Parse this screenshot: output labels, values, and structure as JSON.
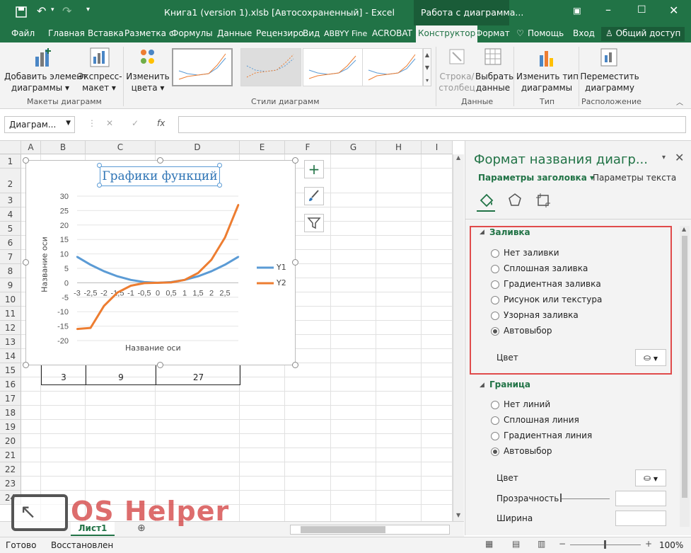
{
  "window": {
    "title": "Книга1 (version 1).xlsb [Автосохраненный] - Excel",
    "context_tab_title": "Работа с диаграмма..."
  },
  "ribbon_tabs": [
    "Файл",
    "Главная",
    "Вставка",
    "Разметка с",
    "Формулы",
    "Данные",
    "Рецензиро",
    "Вид",
    "ABBYY Fine",
    "ACROBAT",
    "Конструктор",
    "Формат"
  ],
  "ribbon_right": {
    "help": "Помощь",
    "signin": "Вход",
    "share": "Общий доступ"
  },
  "ribbon": {
    "add_element": [
      "Добавить элемент",
      "диаграммы ▾"
    ],
    "quick_layout": [
      "Экспресс-",
      "макет ▾"
    ],
    "change_colors": [
      "Изменить",
      "цвета ▾"
    ],
    "group_layouts": "Макеты диаграмм",
    "group_styles": "Стили диаграмм",
    "row_col": [
      "Строка/",
      "столбец"
    ],
    "select_data": [
      "Выбрать",
      "данные"
    ],
    "group_data": "Данные",
    "change_type": [
      "Изменить тип",
      "диаграммы"
    ],
    "group_type": "Тип",
    "move_chart": [
      "Переместить",
      "диаграмму"
    ],
    "group_location": "Расположение"
  },
  "formula_bar": {
    "name_box": "Диаграм...",
    "fx": "fx",
    "value": ""
  },
  "columns": [
    "A",
    "B",
    "C",
    "D",
    "E",
    "F",
    "G",
    "H",
    "I"
  ],
  "rows": [
    "1",
    "2",
    "3",
    "4",
    "5",
    "6",
    "7",
    "8",
    "9",
    "10",
    "11",
    "12",
    "13",
    "14",
    "15",
    "16",
    "17",
    "18",
    "19",
    "20",
    "21",
    "22",
    "23",
    "24"
  ],
  "cells_row15": [
    "3",
    "9",
    "27"
  ],
  "chart": {
    "title": "Графики функций",
    "xlabel": "Название оси",
    "ylabel": "Название оси",
    "xticks": [
      "-3",
      "-2,5",
      "-2",
      "-1,5",
      "-1",
      "-0,5",
      "0",
      "0,5",
      "1",
      "1,5",
      "2",
      "2,5"
    ],
    "yticks": [
      "30",
      "25",
      "20",
      "15",
      "10",
      "5",
      "0",
      "-5",
      "-10",
      "-15",
      "-20"
    ],
    "colors": {
      "y1": "#5b9bd5",
      "y2": "#ed7d31"
    }
  },
  "chart_data": {
    "type": "line",
    "title": "Графики функций",
    "xlabel": "Название оси",
    "ylabel": "Название оси",
    "categories": [
      "-3",
      "-2,5",
      "-2",
      "-1,5",
      "-1",
      "-0,5",
      "0",
      "0,5",
      "1",
      "1,5",
      "2",
      "2,5",
      "3"
    ],
    "series": [
      {
        "name": "Y1",
        "values": [
          9,
          6.25,
          4,
          2.25,
          1,
          0.25,
          0,
          0.25,
          1,
          2.25,
          4,
          6.25,
          9
        ]
      },
      {
        "name": "Y2",
        "values": [
          -27,
          -15.625,
          -8,
          -3.375,
          -1,
          -0.125,
          0,
          0.125,
          1,
          3.375,
          8,
          15.625,
          27
        ]
      }
    ],
    "ylim": [
      -20,
      30
    ],
    "legend": "right",
    "grid": true
  },
  "pane": {
    "title": "Формат названия диагр...",
    "tab_title_params": "Параметры заголовка ▾",
    "tab_text_params": "Параметры текста",
    "fill_section": "Заливка",
    "fill_options": [
      "Нет заливки",
      "Сплошная заливка",
      "Градиентная заливка",
      "Рисунок или текстура",
      "Узорная заливка",
      "Автовыбор"
    ],
    "color_label": "Цвет",
    "border_section": "Граница",
    "border_options": [
      "Нет линий",
      "Сплошная линия",
      "Градиентная линия",
      "Автовыбор"
    ],
    "border_color_label": "Цвет",
    "transparency_label": "Прозрачность",
    "width_label": "Ширина"
  },
  "sheet_tab": "Лист1",
  "watermark": "OS Helper",
  "status": {
    "ready": "Готово",
    "restored": "Восстановлен",
    "zoom": "100%"
  }
}
